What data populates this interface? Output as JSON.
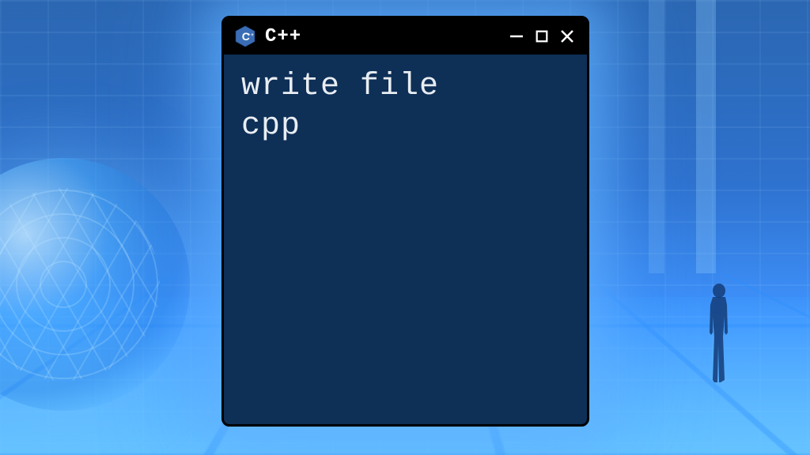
{
  "window": {
    "title": "C++",
    "icon": "cpp-hexagon-icon",
    "controls": {
      "minimize": "minimize",
      "maximize": "maximize",
      "close": "close"
    }
  },
  "content": {
    "line1": "write file",
    "line2": "cpp"
  },
  "colors": {
    "window_bg": "#0e2f56",
    "titlebar_bg": "#000000",
    "text": "#e8edf2",
    "glow": "#64b4ff"
  }
}
